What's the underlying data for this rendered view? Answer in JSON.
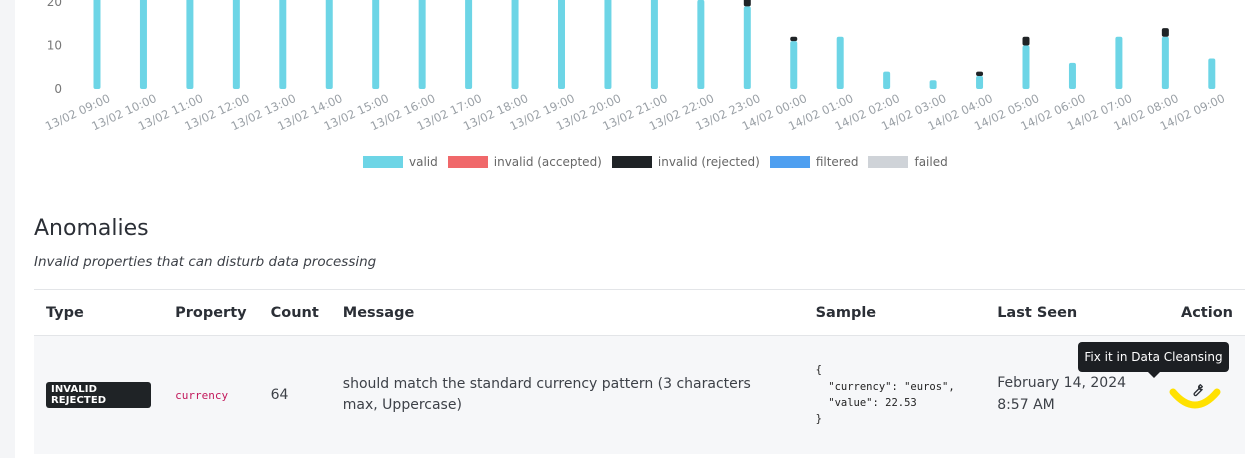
{
  "chart_data": {
    "type": "bar",
    "stacked": true,
    "categories": [
      "13/02 09:00",
      "13/02 10:00",
      "13/02 11:00",
      "13/02 12:00",
      "13/02 13:00",
      "13/02 14:00",
      "13/02 15:00",
      "13/02 16:00",
      "13/02 17:00",
      "13/02 18:00",
      "13/02 19:00",
      "13/02 20:00",
      "13/02 21:00",
      "13/02 22:00",
      "13/02 23:00",
      "14/02 00:00",
      "14/02 01:00",
      "14/02 02:00",
      "14/02 03:00",
      "14/02 04:00",
      "14/02 05:00",
      "14/02 06:00",
      "14/02 07:00",
      "14/02 08:00",
      "14/02 09:00"
    ],
    "series": [
      {
        "name": "valid",
        "color": "#6dd5e6",
        "values": [
          21,
          21,
          21,
          21,
          21,
          21,
          21,
          21,
          21,
          21,
          21,
          21,
          21,
          20.5,
          19,
          11,
          12,
          4,
          2,
          3,
          10,
          6,
          12,
          12,
          7
        ]
      },
      {
        "name": "invalid (accepted)",
        "color": "#f0686a",
        "values": [
          0,
          0,
          0,
          0,
          0,
          0,
          0,
          0,
          0,
          0,
          0,
          0,
          0,
          0,
          0,
          0,
          0,
          0,
          0,
          0,
          0,
          0,
          0,
          0,
          0
        ]
      },
      {
        "name": "invalid (rejected)",
        "color": "#1f2326",
        "values": [
          0,
          0,
          0,
          0,
          0,
          0,
          0,
          0,
          0,
          0,
          0,
          0,
          0,
          0,
          2,
          1,
          0,
          0,
          0,
          1,
          2,
          0,
          0,
          2,
          0
        ]
      },
      {
        "name": "filtered",
        "color": "#4e9ff0",
        "values": [
          0,
          0,
          0,
          0,
          0,
          0,
          0,
          0,
          0,
          0,
          0,
          0,
          0,
          0,
          0,
          0,
          0,
          0,
          0,
          0,
          0,
          0,
          0,
          0,
          0
        ]
      },
      {
        "name": "failed",
        "color": "#cfd3d8",
        "values": [
          0,
          0,
          0,
          0,
          0,
          0,
          0,
          0,
          0,
          0,
          0,
          0,
          0,
          0,
          0,
          0,
          0,
          0,
          0,
          0,
          0,
          0,
          0,
          0,
          0
        ]
      }
    ],
    "yticks": [
      0,
      10,
      20
    ],
    "ylim": [
      0,
      21
    ],
    "legend_position": "bottom",
    "grid": false
  },
  "anomalies": {
    "title": "Anomalies",
    "subtitle": "Invalid properties that can disturb data processing",
    "columns": {
      "type": "Type",
      "property": "Property",
      "count": "Count",
      "message": "Message",
      "sample": "Sample",
      "last_seen": "Last Seen",
      "action": "Action"
    },
    "row": {
      "type": "INVALID REJECTED",
      "property": "currency",
      "count": "64",
      "message": "should match the standard currency pattern (3 characters max, Uppercase)",
      "sample": "{\n  \"currency\": \"euros\",\n  \"value\": 22.53\n}",
      "last_seen": "February 14, 2024 8:57 AM",
      "action_icon": "wrench-icon",
      "tooltip": "Fix it in Data Cleansing"
    }
  },
  "colors": {
    "highlight": "#ffe100"
  }
}
